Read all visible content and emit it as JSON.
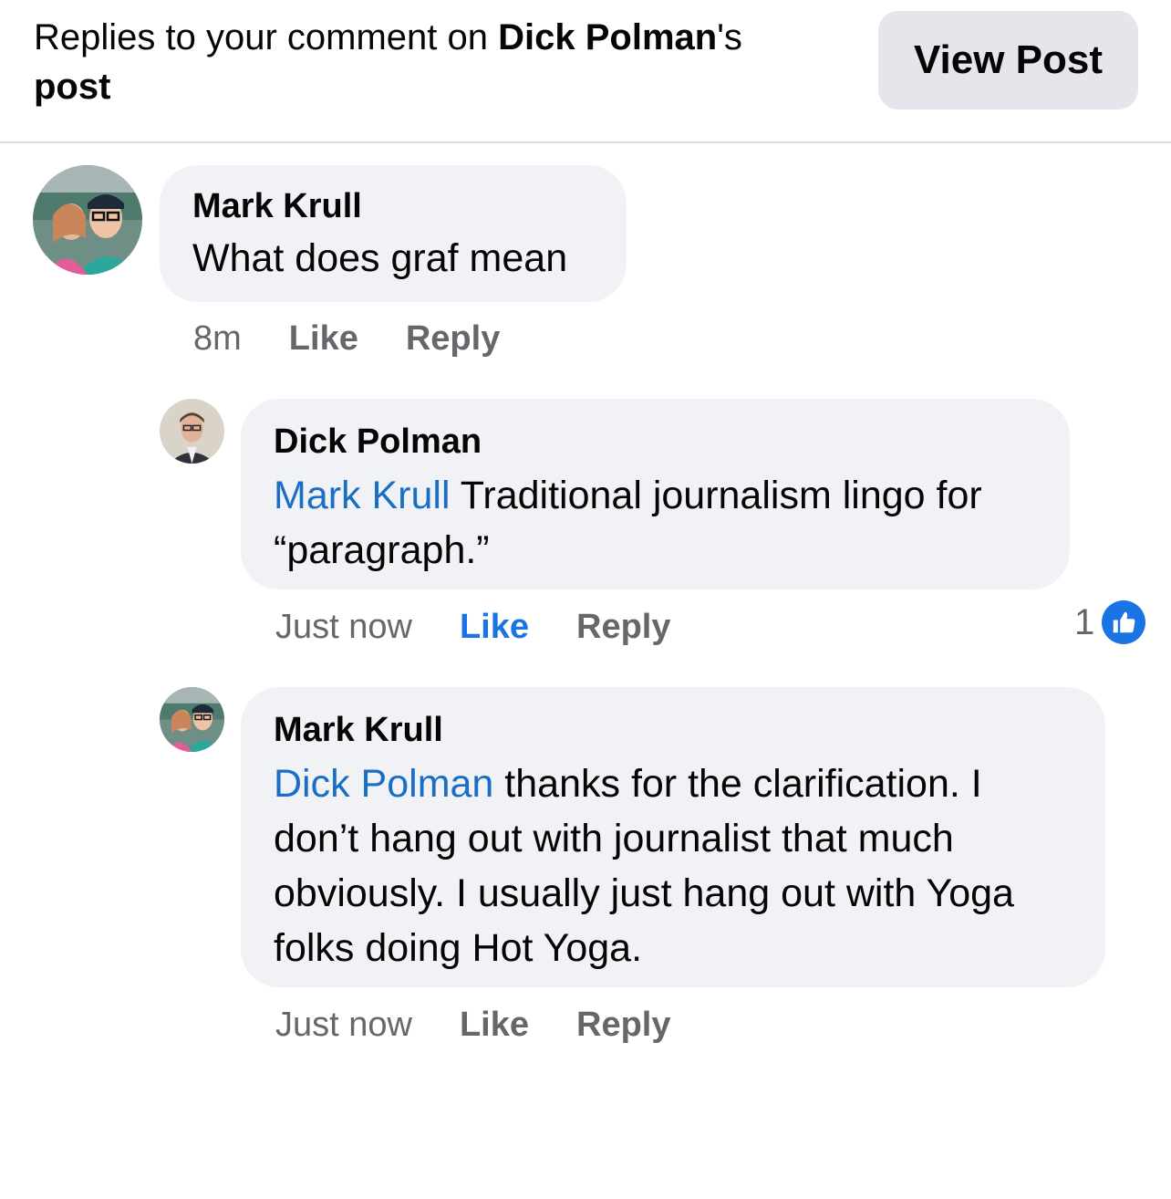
{
  "header": {
    "title_prefix": "Replies to your comment on ",
    "title_name": "Dick Polman",
    "title_suffix": "'s",
    "title_line2": "post",
    "view_post_label": "View Post"
  },
  "comments": [
    {
      "author": "Mark Krull",
      "mention": "",
      "text": "What does graf mean",
      "time": "8m",
      "like_label": "Like",
      "reply_label": "Reply",
      "avatar": "couple-selfie-avatar"
    },
    {
      "author": "Dick Polman",
      "mention": "Mark Krull",
      "text": " Traditional journalism lingo for “paragraph.”",
      "time": "Just now",
      "like_label": "Like",
      "reply_label": "Reply",
      "liked": true,
      "reaction_count": "1",
      "avatar": "man-in-suit-avatar"
    },
    {
      "author": "Mark Krull",
      "mention": "Dick Polman",
      "text": " thanks for the clarification. I don’t hang out with journalist that much obviously. I usually just hang out with Yoga folks doing Hot Yoga.",
      "time": "Just now",
      "like_label": "Like",
      "reply_label": "Reply",
      "avatar": "couple-selfie-avatar"
    }
  ],
  "colors": {
    "bubble": "#f0f2f5",
    "mention": "#1b6ec6",
    "liked": "#1b74e4",
    "muted": "#65676b",
    "button": "#e4e6eb"
  }
}
